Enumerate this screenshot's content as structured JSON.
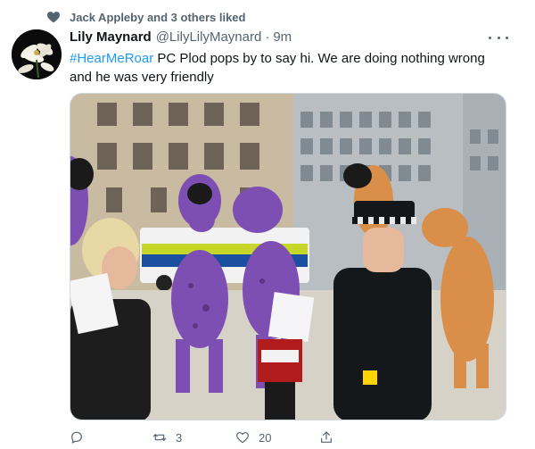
{
  "social_context": {
    "text": "Jack Appleby and 3 others liked",
    "icon": "heart-icon"
  },
  "author": {
    "name": "Lily Maynard",
    "handle": "@LilyLilyMaynard",
    "separator": "·",
    "time": "9m"
  },
  "tweet": {
    "hashtag": "#HearMeRoar",
    "text_rest": " PC Plod pops by to say hi. We are doing nothing wrong and he was very friendly"
  },
  "actions": {
    "reply": {
      "icon": "reply-icon",
      "count": ""
    },
    "retweet": {
      "icon": "retweet-icon",
      "count": "3"
    },
    "like": {
      "icon": "like-icon",
      "count": "20"
    },
    "share": {
      "icon": "share-icon",
      "count": ""
    }
  },
  "colors": {
    "accent": "#1d9bf0",
    "secondary_text": "#536471",
    "primary_text": "#0f1419"
  }
}
